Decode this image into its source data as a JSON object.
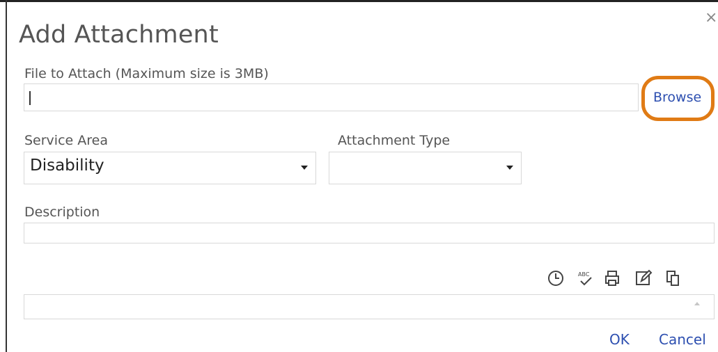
{
  "dialog": {
    "title": "Add Attachment",
    "file_label": "File to Attach (Maximum size is 3MB)",
    "file_value": "",
    "browse_label": "Browse",
    "service_area_label": "Service Area",
    "service_area_value": "Disability",
    "attachment_type_label": "Attachment Type",
    "attachment_type_value": "",
    "description_label": "Description",
    "description_value": "",
    "notes_value": "",
    "ok_label": "OK",
    "cancel_label": "Cancel"
  },
  "toolbar": {
    "icons": [
      "clock-icon",
      "spellcheck-icon",
      "print-icon",
      "edit-icon",
      "copy-icon"
    ]
  },
  "colors": {
    "accent_link": "#2d4fb0",
    "highlight_ring": "#e07b15",
    "border": "#d8d8d8"
  }
}
